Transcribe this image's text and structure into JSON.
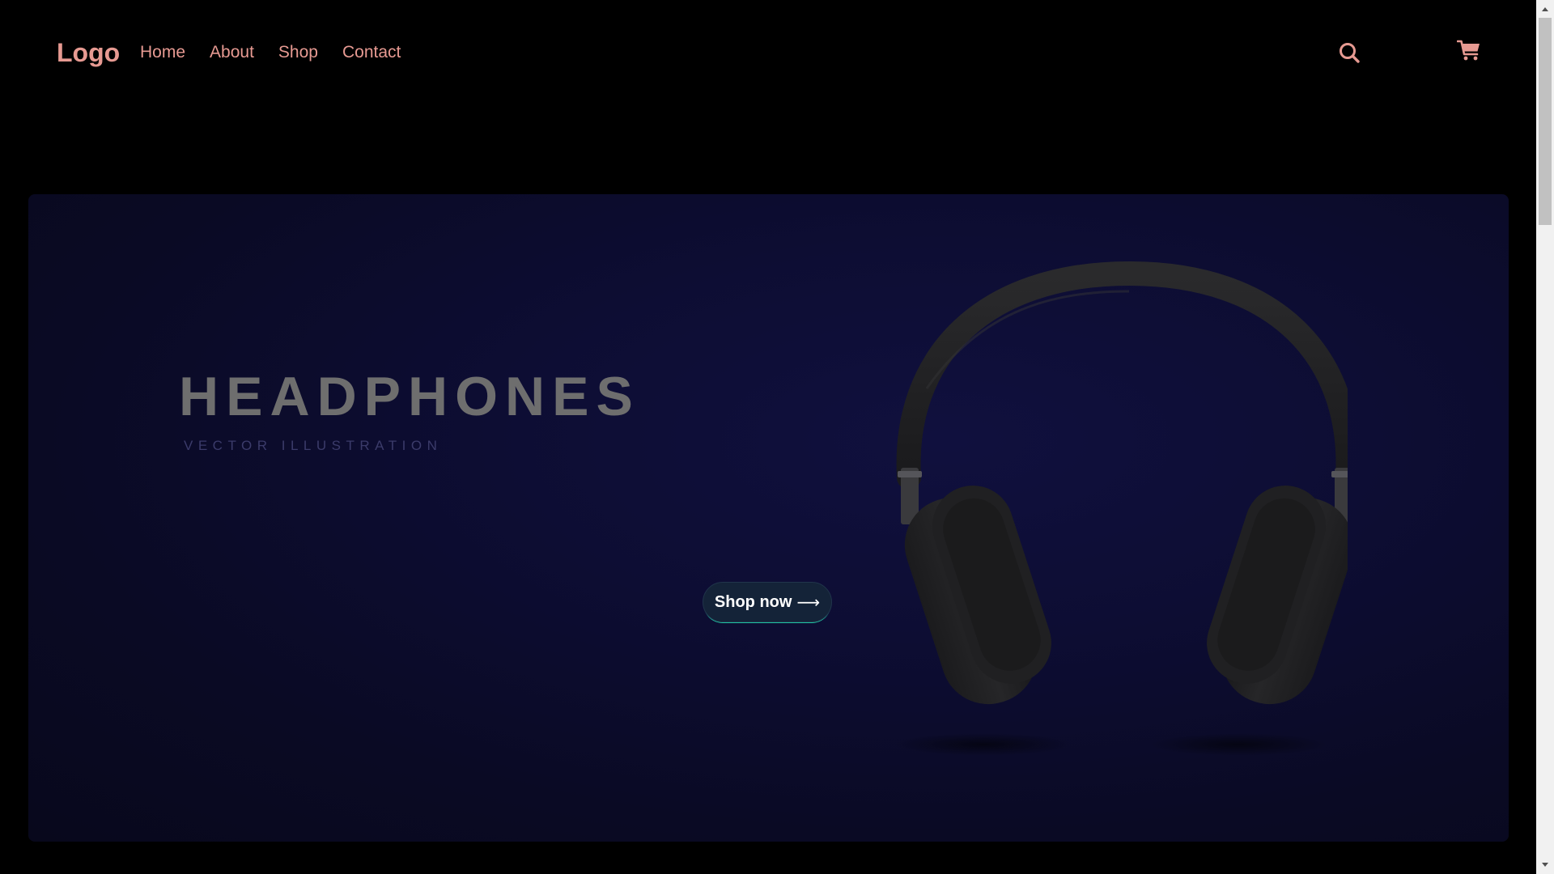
{
  "header": {
    "logo": "Logo",
    "nav": [
      "Home",
      "About",
      "Shop",
      "Contact"
    ],
    "icons": [
      "search-icon",
      "cart-icon"
    ]
  },
  "hero": {
    "title": "HEADPHONES",
    "subtitle": "VECTOR ILLUSTRATION",
    "cta_label": "Shop now",
    "cta_arrow": "⟶",
    "image": "headphones-illustration"
  },
  "colors": {
    "accent": "#e79a92",
    "page_background": "#000000",
    "hero_background": "#0d0d33",
    "title_color": "#6e6e6e",
    "subtitle_color": "#3b3b6a",
    "button_background": "#142338",
    "button_underline": "#1fc4a2"
  }
}
